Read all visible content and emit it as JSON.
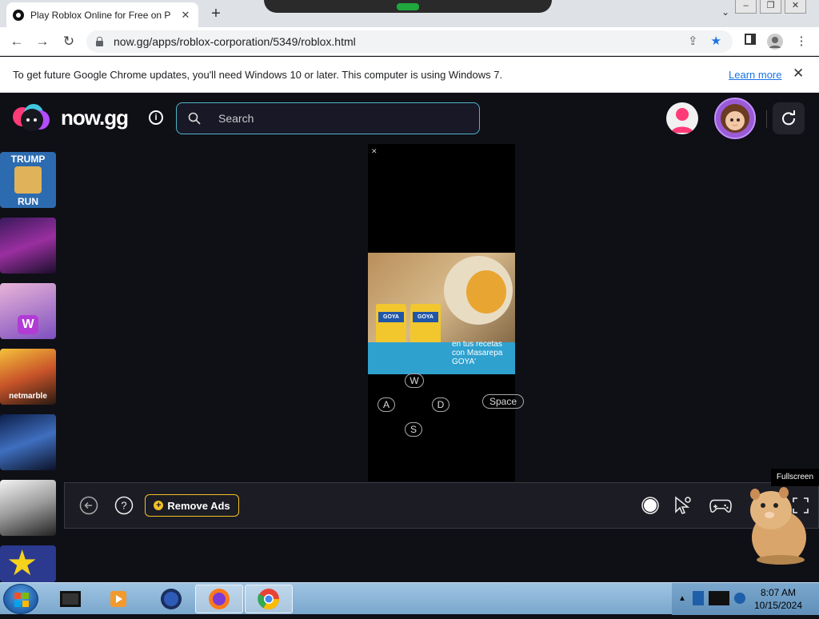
{
  "browser": {
    "tab_title": "Play Roblox Online for Free on P",
    "tab_close": "✕",
    "new_tab": "+",
    "tab_menu": "⌄",
    "url": "now.gg/apps/roblox-corporation/5349/roblox.html",
    "window_controls": [
      "–",
      "❐",
      "✕"
    ],
    "nav": {
      "back": "←",
      "forward": "→",
      "reload": "↻"
    },
    "omnibox_icons": {
      "share": "⇪",
      "bookmark": "★"
    },
    "menu": "⋮"
  },
  "infobar": {
    "message": "To get future Google Chrome updates, you'll need Windows 10 or later. This computer is using Windows 7.",
    "learn_more": "Learn more",
    "close": "✕"
  },
  "header": {
    "logo_text": "now.gg",
    "info": "i",
    "search_placeholder": "Search"
  },
  "sidebar": {
    "tiles": [
      {
        "line1": "TRUMP",
        "line2": "RUN"
      },
      {
        "label": ""
      },
      {
        "label": "W"
      },
      {
        "label": "netmarble"
      },
      {
        "label": ""
      },
      {
        "label": ""
      },
      {
        "label": "★"
      }
    ]
  },
  "ad": {
    "brand": "GOYA",
    "caption": [
      "en tus recetas",
      "con Masarepa",
      "GOYA'"
    ]
  },
  "keys": {
    "w": "W",
    "a": "A",
    "d": "D",
    "s": "S",
    "space": "Space"
  },
  "controlbar": {
    "remove_ads": "Remove Ads",
    "plus": "+",
    "tooltip": "Fullscreen"
  },
  "taskbar": {
    "time": "8:07 AM",
    "date": "10/15/2024"
  },
  "colors": {
    "accent_search_border": "#4fb6c9",
    "remove_ads_border": "#f3c024",
    "page_bg": "#0f0f16"
  }
}
